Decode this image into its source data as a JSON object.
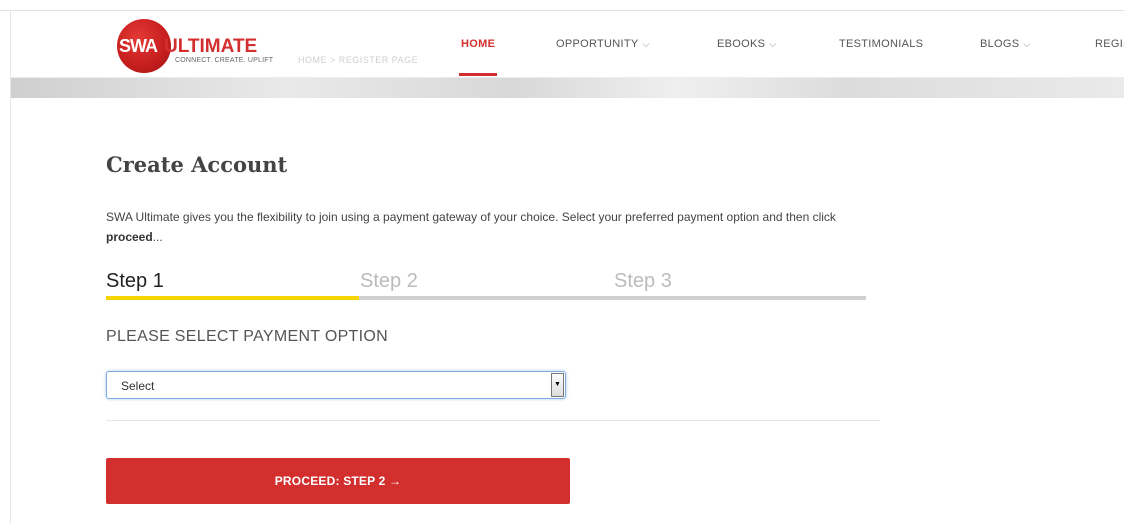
{
  "logo": {
    "swa": "SWA",
    "ultimate": "ULTIMATE",
    "tagline": "CONNECT. CREATE. UPLIFT"
  },
  "breadcrumb": "HOME  >  REGISTER PAGE",
  "nav": {
    "items": [
      {
        "label": "HOME",
        "active": true,
        "dropdown": false
      },
      {
        "label": "OPPORTUNITY",
        "active": false,
        "dropdown": true
      },
      {
        "label": "EBOOKS",
        "active": false,
        "dropdown": true
      },
      {
        "label": "TESTIMONIALS",
        "active": false,
        "dropdown": false
      },
      {
        "label": "BLOGS",
        "active": false,
        "dropdown": true
      },
      {
        "label": "REGIS",
        "active": false,
        "dropdown": false
      }
    ],
    "chevron": "⌵"
  },
  "page": {
    "title": "Create Account",
    "intro_text": "SWA Ultimate gives you the flexibility to join using a payment gateway of your choice. Select your preferred payment option and then click ",
    "intro_bold": "proceed",
    "intro_suffix": "..."
  },
  "steps": [
    {
      "label": "Step 1",
      "active": true
    },
    {
      "label": "Step 2",
      "active": false
    },
    {
      "label": "Step 3",
      "active": false
    }
  ],
  "progress": {
    "completed_fraction": 0.333
  },
  "payment": {
    "label": "PLEASE SELECT PAYMENT OPTION",
    "selected": "Select"
  },
  "proceed_button": "PROCEED: STEP 2 →",
  "colors": {
    "accent": "#d32f2f",
    "progress": "#f6d400",
    "track": "#d0d0d0"
  }
}
